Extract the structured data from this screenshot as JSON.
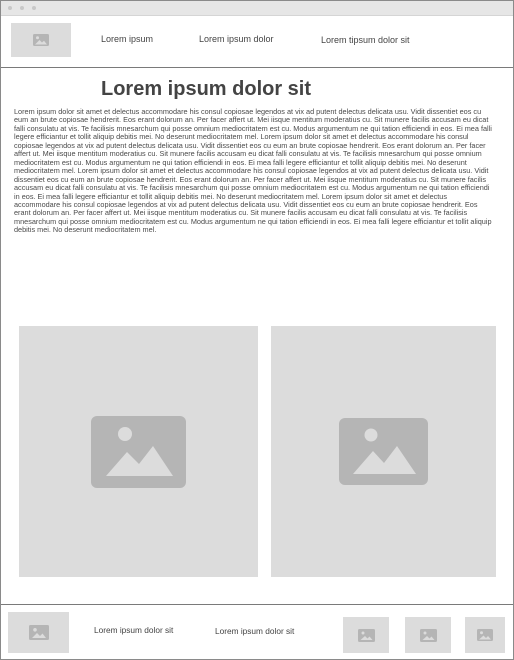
{
  "header": {
    "logo_icon": "image-placeholder-icon",
    "nav": [
      "Lorem ipsum",
      "Lorem ipsum dolor",
      "Lorem tipsum dolor sit"
    ]
  },
  "article": {
    "title": "Lorem ipsum dolor sit",
    "body": "Lorem ipsum dolor sit amet et delectus accommodare his consul copiosae legendos at vix ad putent delectus delicata usu. Vidit dissentiet eos cu eum an brute copiosae hendrerit. Eos erant dolorum an. Per facer affert ut. Mei iisque mentitum moderatius cu. Sit munere facilis accusam eu dicat falli consulatu at vis. Te facilisis mnesarchum qui posse omnium mediocritatem est cu. Modus argumentum ne qui tation efficiendi in eos. Ei mea falli legere efficiantur et tollit aliquip debitis mei. No deserunt mediocritatem mel. Lorem ipsum dolor sit amet et delectus accommodare his consul copiosae legendos at vix ad putent delectus delicata usu. Vidit dissentiet eos cu eum an brute copiosae hendrerit. Eos erant dolorum an. Per facer affert ut. Mei iisque mentitum moderatius cu. Sit munere facilis accusam eu dicat falli consulatu at vis. Te facilisis mnesarchum qui posse omnium mediocritatem est cu. Modus argumentum ne qui tation efficiendi in eos. Ei mea falli legere efficiantur et tollit aliquip debitis mei. No deserunt mediocritatem mel. Lorem ipsum dolor sit amet et delectus accommodare his consul copiosae legendos at vix ad putent delectus delicata usu. Vidit dissentiet eos cu eum an brute copiosae hendrerit. Eos erant dolorum an. Per facer affert ut. Mei iisque mentitum moderatius cu. Sit munere facilis accusam eu dicat falli consulatu at vis. Te facilisis mnesarchum qui posse omnium mediocritatem est cu. Modus argumentum ne qui tation efficiendi in eos. Ei mea falli legere efficiantur et tollit aliquip debitis mei. No deserunt mediocritatem mel. Lorem ipsum dolor sit amet et delectus accommodare his consul copiosae legendos at vix ad putent delectus delicata usu. Vidit dissentiet eos cu eum an brute copiosae hendrerit. Eos erant dolorum an. Per facer affert ut. Mei iisque mentitum moderatius cu. Sit munere facilis accusam eu dicat falli consulatu at vis. Te facilisis mnesarchum qui posse omnium mediocritatem est cu. Modus argumentum ne qui tation efficiendi in eos. Ei mea falli legere efficiantur et tollit aliquip debitis mei. No deserunt mediocritatem mel."
  },
  "gallery": {
    "images": [
      "image-placeholder-icon",
      "image-placeholder-icon"
    ]
  },
  "footer": {
    "links": [
      "Lorem ipsum dolor sit",
      "Lorem ipsum dolor sit"
    ],
    "icons": [
      "image-placeholder-icon",
      "image-placeholder-icon",
      "image-placeholder-icon",
      "image-placeholder-icon"
    ]
  },
  "colors": {
    "placeholder_bg": "#dcdcdc",
    "placeholder_icon": "#b5b5b5",
    "divider": "#7a7a7a"
  }
}
